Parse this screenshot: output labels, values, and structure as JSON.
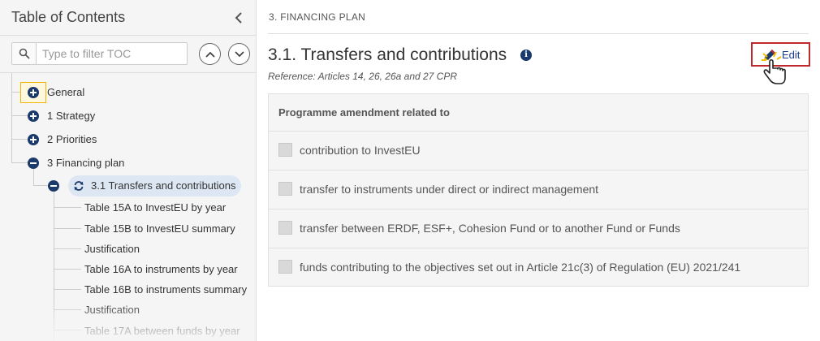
{
  "sidebar": {
    "title": "Table of Contents",
    "filter_placeholder": "Type to filter TOC",
    "tree": [
      {
        "label": "General",
        "state": "expand"
      },
      {
        "label": "1 Strategy",
        "state": "expand"
      },
      {
        "label": "2 Priorities",
        "state": "expand"
      },
      {
        "label": "3 Financing plan",
        "state": "collapse"
      },
      {
        "label": "3.1 Transfers and contributions",
        "state": "collapse",
        "selected": true
      },
      {
        "label": "Table 15A to InvestEU by year"
      },
      {
        "label": "Table 15B to InvestEU summary"
      },
      {
        "label": "Justification"
      },
      {
        "label": "Table 16A to instruments by year"
      },
      {
        "label": "Table 16B to instruments summary"
      },
      {
        "label": "Justification"
      },
      {
        "label": "Table 17A between funds by year"
      }
    ]
  },
  "main": {
    "section_label": "3. FINANCING PLAN",
    "title": "3.1. Transfers and contributions",
    "reference": "Reference: Articles 14, 26, 26a and 27 CPR",
    "edit_label": "Edit",
    "panel_header": "Programme amendment related to",
    "options": [
      {
        "label": "contribution to InvestEU",
        "checked": false
      },
      {
        "label": "transfer to instruments under direct or indirect management",
        "checked": false
      },
      {
        "label": "transfer between ERDF, ESF+, Cohesion Fund or to another Fund or Funds",
        "checked": false
      },
      {
        "label": "funds contributing to the objectives set out in Article 21c(3) of Regulation (EU) 2021/241",
        "checked": false
      }
    ]
  },
  "icons": {
    "collapse": "chevron-left-icon",
    "search": "search-icon",
    "nav_up": "chevron-up-icon",
    "nav_down": "chevron-down-icon",
    "info": "info-icon",
    "edit": "pencil-icon",
    "cursor": "hand-pointer-icon",
    "refresh": "refresh-icon"
  },
  "colors": {
    "accent": "#1a3a6b",
    "edit_border": "#c0282d",
    "selected_bg": "#dde7f3",
    "focus_border": "#f0b400"
  }
}
